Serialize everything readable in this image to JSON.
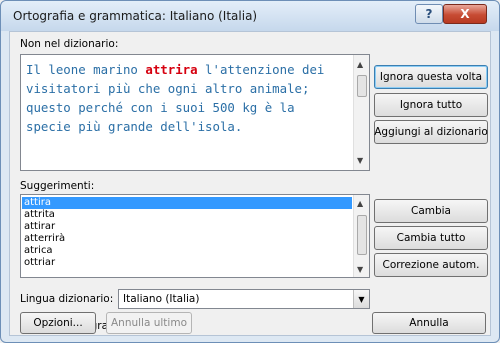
{
  "window": {
    "title": "Ortografia e grammatica: Italiano (Italia)",
    "help_label": "?",
    "close_label": "X"
  },
  "not_in_dictionary": {
    "label": "Non nel dizionario:",
    "sentence_before": "Il leone marino ",
    "error_word": "attrira",
    "sentence_after": " l'attenzione dei visitatori più che ogni altro animale; questo perché con i suoi 500 kg è la specie più grande dell'isola."
  },
  "suggestions": {
    "label": "Suggerimenti:",
    "items": [
      "attira",
      "attrita",
      "attirar",
      "atterrirà",
      "atrica",
      "ottriar"
    ],
    "selected_index": 0
  },
  "buttons": {
    "ignore_once": "Ignora questa volta",
    "ignore_all": "Ignora tutto",
    "add_to_dictionary": "Aggiungi al dizionario",
    "change": "Cambia",
    "change_all": "Cambia tutto",
    "autocorrect": "Correzione autom.",
    "options": "Opzioni...",
    "undo_last": "Annulla ultimo",
    "cancel": "Annulla"
  },
  "dictionary_language": {
    "label": "Lingua dizionario:",
    "value": "Italiano (Italia)"
  },
  "check_grammar": {
    "label": "Controlla grammatica",
    "checked": true
  },
  "colors": {
    "sentence_text": "#2b6fa6",
    "error_word": "#d6000f",
    "selection": "#3399ff"
  }
}
